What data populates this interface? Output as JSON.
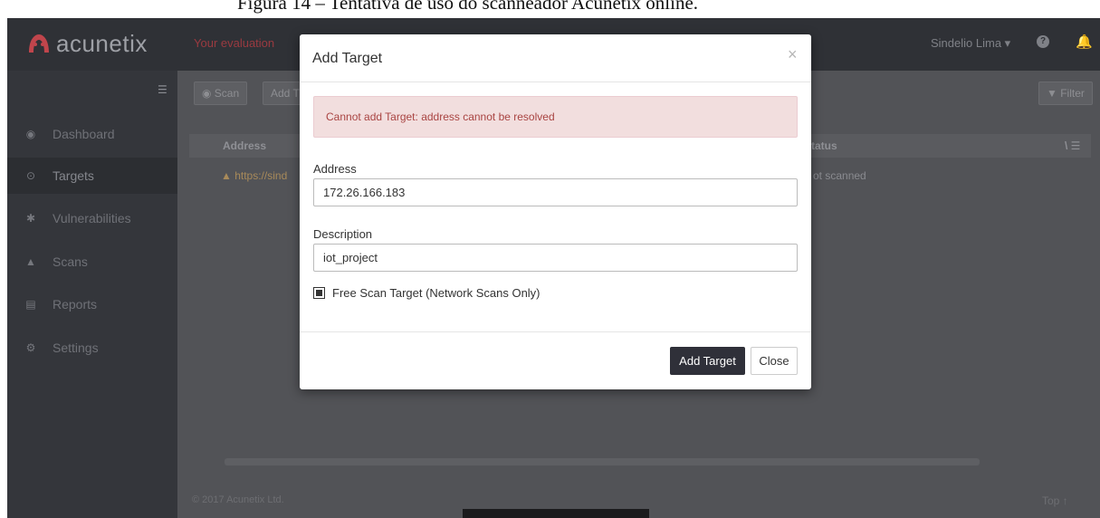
{
  "caption": {
    "text": "Figura 14 – Tentativa de uso do scanneador Acunetix online."
  },
  "topbar": {
    "logo_text": "acunetix",
    "evaluation_text": "Your evaluation",
    "user_name": "Sindelio Lima ▾",
    "help_icon": "?",
    "bell_icon": "🔔"
  },
  "sidebar": {
    "items": [
      {
        "label": "Dashboard",
        "icon": "dashboard-icon",
        "glyph": "◉"
      },
      {
        "label": "Targets",
        "icon": "targets-icon",
        "glyph": "⊙"
      },
      {
        "label": "Vulnerabilities",
        "icon": "bug-icon",
        "glyph": "✱"
      },
      {
        "label": "Scans",
        "icon": "scans-icon",
        "glyph": "▲"
      },
      {
        "label": "Reports",
        "icon": "reports-icon",
        "glyph": "▤"
      },
      {
        "label": "Settings",
        "icon": "gear-icon",
        "glyph": "⚙"
      }
    ],
    "toggle_glyph": "☰"
  },
  "toolbar": {
    "scan_label": "◉ Scan",
    "add_label": "Add T",
    "filter_label": "▼ Filter"
  },
  "table": {
    "headers": {
      "address": "Address",
      "status": "tatus",
      "menu": "\\ ☰"
    },
    "rows": [
      {
        "address": "▲ https://sind",
        "status": "ot scanned"
      }
    ]
  },
  "footer": {
    "copyright": "© 2017 Acunetix Ltd.",
    "top": "Top ↑"
  },
  "modal": {
    "title": "Add Target",
    "close": "×",
    "alert": "Cannot add Target: address cannot be resolved",
    "address_label": "Address",
    "address_value": "172.26.166.183",
    "description_label": "Description",
    "description_value": "iot_project",
    "free_scan_label": "Free Scan Target (Network Scans Only)",
    "free_scan_checked": true,
    "add_button": "Add Target",
    "close_button": "Close"
  },
  "colors": {
    "primary_button": "#2f3039",
    "alert_bg": "#f2dede",
    "alert_text": "#a94442",
    "logo_red": "#c0454c"
  }
}
